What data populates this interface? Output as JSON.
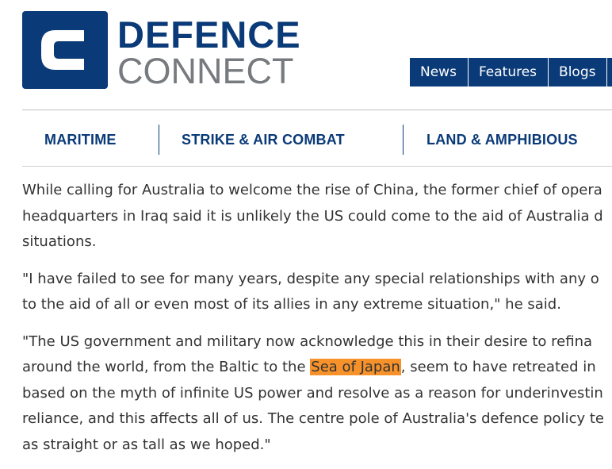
{
  "logo": {
    "line1": "DEFENCE",
    "line2": "CONNECT",
    "badge_letter": "C"
  },
  "topnav": {
    "items": [
      "News",
      "Features",
      "Blogs",
      ""
    ]
  },
  "categories": [
    "MARITIME",
    "STRIKE & AIR COMBAT",
    "LAND & AMPHIBIOUS"
  ],
  "article": {
    "p1": [
      "While calling for Australia to welcome the rise of China, the former chief of opera",
      "headquarters in Iraq said it is unlikely the US could come to the aid of Australia d",
      "situations."
    ],
    "p2": [
      "\"I have failed to see for many years, despite any special relationships with any o",
      "to the aid of all or even most of its allies in any extreme situation,\" he said."
    ],
    "p3": {
      "line1": "\"The US government and military now acknowledge this in their desire to refina",
      "line2_before": "around the world, from the Baltic to the ",
      "line2_highlight": "Sea of Japan",
      "line2_after": ", seem to have retreated in",
      "line3": "based on the myth of infinite US power and resolve as a reason for underinvestin",
      "line4": "reliance, and this affects all of us. The centre pole of Australia's defence policy te",
      "line5": "as straight or as tall as we hoped.\""
    }
  },
  "colors": {
    "brand_blue": "#0a3a78",
    "brand_gray": "#777b80",
    "highlight": "#f7922a",
    "text": "#333333"
  }
}
